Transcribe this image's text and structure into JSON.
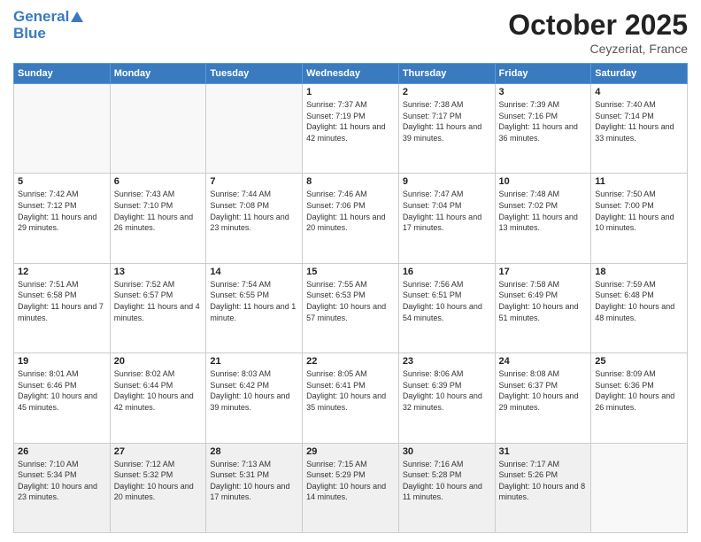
{
  "header": {
    "logo_line1": "General",
    "logo_line2": "Blue",
    "month": "October 2025",
    "location": "Ceyzeriat, France"
  },
  "days_of_week": [
    "Sunday",
    "Monday",
    "Tuesday",
    "Wednesday",
    "Thursday",
    "Friday",
    "Saturday"
  ],
  "weeks": [
    [
      {
        "day": "",
        "text": ""
      },
      {
        "day": "",
        "text": ""
      },
      {
        "day": "",
        "text": ""
      },
      {
        "day": "1",
        "text": "Sunrise: 7:37 AM\nSunset: 7:19 PM\nDaylight: 11 hours and 42 minutes."
      },
      {
        "day": "2",
        "text": "Sunrise: 7:38 AM\nSunset: 7:17 PM\nDaylight: 11 hours and 39 minutes."
      },
      {
        "day": "3",
        "text": "Sunrise: 7:39 AM\nSunset: 7:16 PM\nDaylight: 11 hours and 36 minutes."
      },
      {
        "day": "4",
        "text": "Sunrise: 7:40 AM\nSunset: 7:14 PM\nDaylight: 11 hours and 33 minutes."
      }
    ],
    [
      {
        "day": "5",
        "text": "Sunrise: 7:42 AM\nSunset: 7:12 PM\nDaylight: 11 hours and 29 minutes."
      },
      {
        "day": "6",
        "text": "Sunrise: 7:43 AM\nSunset: 7:10 PM\nDaylight: 11 hours and 26 minutes."
      },
      {
        "day": "7",
        "text": "Sunrise: 7:44 AM\nSunset: 7:08 PM\nDaylight: 11 hours and 23 minutes."
      },
      {
        "day": "8",
        "text": "Sunrise: 7:46 AM\nSunset: 7:06 PM\nDaylight: 11 hours and 20 minutes."
      },
      {
        "day": "9",
        "text": "Sunrise: 7:47 AM\nSunset: 7:04 PM\nDaylight: 11 hours and 17 minutes."
      },
      {
        "day": "10",
        "text": "Sunrise: 7:48 AM\nSunset: 7:02 PM\nDaylight: 11 hours and 13 minutes."
      },
      {
        "day": "11",
        "text": "Sunrise: 7:50 AM\nSunset: 7:00 PM\nDaylight: 11 hours and 10 minutes."
      }
    ],
    [
      {
        "day": "12",
        "text": "Sunrise: 7:51 AM\nSunset: 6:58 PM\nDaylight: 11 hours and 7 minutes."
      },
      {
        "day": "13",
        "text": "Sunrise: 7:52 AM\nSunset: 6:57 PM\nDaylight: 11 hours and 4 minutes."
      },
      {
        "day": "14",
        "text": "Sunrise: 7:54 AM\nSunset: 6:55 PM\nDaylight: 11 hours and 1 minute."
      },
      {
        "day": "15",
        "text": "Sunrise: 7:55 AM\nSunset: 6:53 PM\nDaylight: 10 hours and 57 minutes."
      },
      {
        "day": "16",
        "text": "Sunrise: 7:56 AM\nSunset: 6:51 PM\nDaylight: 10 hours and 54 minutes."
      },
      {
        "day": "17",
        "text": "Sunrise: 7:58 AM\nSunset: 6:49 PM\nDaylight: 10 hours and 51 minutes."
      },
      {
        "day": "18",
        "text": "Sunrise: 7:59 AM\nSunset: 6:48 PM\nDaylight: 10 hours and 48 minutes."
      }
    ],
    [
      {
        "day": "19",
        "text": "Sunrise: 8:01 AM\nSunset: 6:46 PM\nDaylight: 10 hours and 45 minutes."
      },
      {
        "day": "20",
        "text": "Sunrise: 8:02 AM\nSunset: 6:44 PM\nDaylight: 10 hours and 42 minutes."
      },
      {
        "day": "21",
        "text": "Sunrise: 8:03 AM\nSunset: 6:42 PM\nDaylight: 10 hours and 39 minutes."
      },
      {
        "day": "22",
        "text": "Sunrise: 8:05 AM\nSunset: 6:41 PM\nDaylight: 10 hours and 35 minutes."
      },
      {
        "day": "23",
        "text": "Sunrise: 8:06 AM\nSunset: 6:39 PM\nDaylight: 10 hours and 32 minutes."
      },
      {
        "day": "24",
        "text": "Sunrise: 8:08 AM\nSunset: 6:37 PM\nDaylight: 10 hours and 29 minutes."
      },
      {
        "day": "25",
        "text": "Sunrise: 8:09 AM\nSunset: 6:36 PM\nDaylight: 10 hours and 26 minutes."
      }
    ],
    [
      {
        "day": "26",
        "text": "Sunrise: 7:10 AM\nSunset: 5:34 PM\nDaylight: 10 hours and 23 minutes."
      },
      {
        "day": "27",
        "text": "Sunrise: 7:12 AM\nSunset: 5:32 PM\nDaylight: 10 hours and 20 minutes."
      },
      {
        "day": "28",
        "text": "Sunrise: 7:13 AM\nSunset: 5:31 PM\nDaylight: 10 hours and 17 minutes."
      },
      {
        "day": "29",
        "text": "Sunrise: 7:15 AM\nSunset: 5:29 PM\nDaylight: 10 hours and 14 minutes."
      },
      {
        "day": "30",
        "text": "Sunrise: 7:16 AM\nSunset: 5:28 PM\nDaylight: 10 hours and 11 minutes."
      },
      {
        "day": "31",
        "text": "Sunrise: 7:17 AM\nSunset: 5:26 PM\nDaylight: 10 hours and 8 minutes."
      },
      {
        "day": "",
        "text": ""
      }
    ]
  ]
}
